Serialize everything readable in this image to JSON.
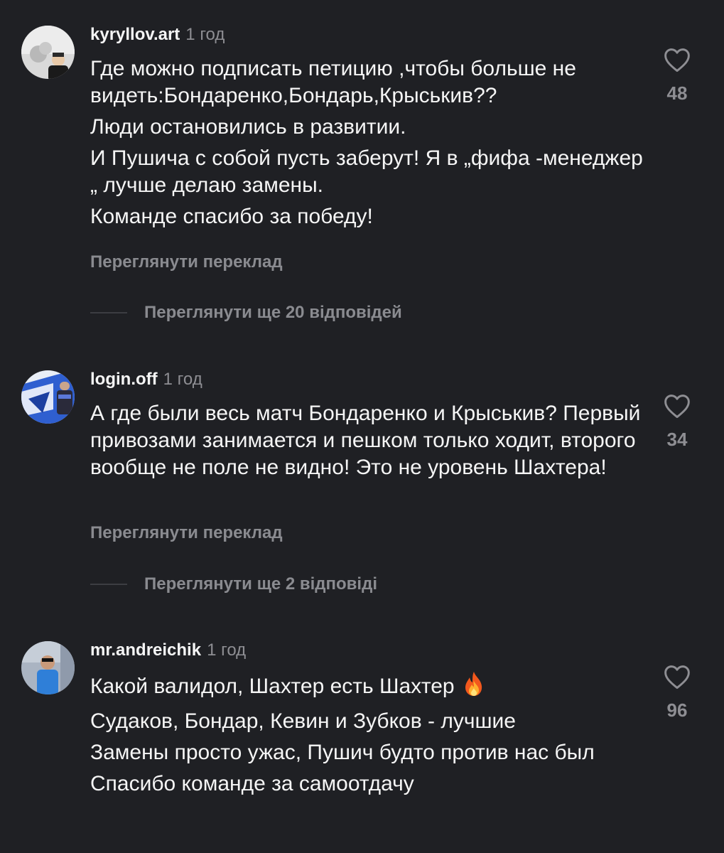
{
  "comments": [
    {
      "username": "kyryllov.art",
      "time": "1 год",
      "paragraphs": [
        "Где можно подписать петицию ,чтобы больше не видеть:Бондаренко,Бондарь,Крыськив??",
        "Люди остановились в развитии.",
        "И Пушича с собой пусть заберут! Я в „фифа -менеджер „ лучше делаю замены.",
        "Команде спасибо за победу!"
      ],
      "translate_label": "Переглянути переклад",
      "replies_label": "Переглянути ще 20 відповідей",
      "like_count": "48",
      "like_icon": "heart-outline-icon"
    },
    {
      "username": "login.off",
      "time": "1 год",
      "paragraphs": [
        "А где были весь матч Бондаренко и Крыськив? Первый привозами занимается и пешком только ходит, второго вообще не поле не видно! Это не уровень Шахтера!"
      ],
      "translate_label": "Переглянути переклад",
      "replies_label": "Переглянути ще 2 відповіді",
      "like_count": "34",
      "like_icon": "heart-outline-icon"
    },
    {
      "username": "mr.andreichik",
      "time": "1 год",
      "paragraphs": [
        "Какой валидол, Шахтер есть Шахтер",
        "Судаков, Бондар, Кевин и Зубков - лучшие",
        "Замены просто ужас, Пушич будто против нас был",
        "Спасибо команде за самоотдачу"
      ],
      "emoji": "fire-emoji",
      "like_count": "96",
      "like_icon": "heart-outline-icon"
    }
  ],
  "colors": {
    "background": "#1f2024",
    "text": "#f5f5f5",
    "secondary": "#8e8e93",
    "link": "#8a8b90"
  }
}
